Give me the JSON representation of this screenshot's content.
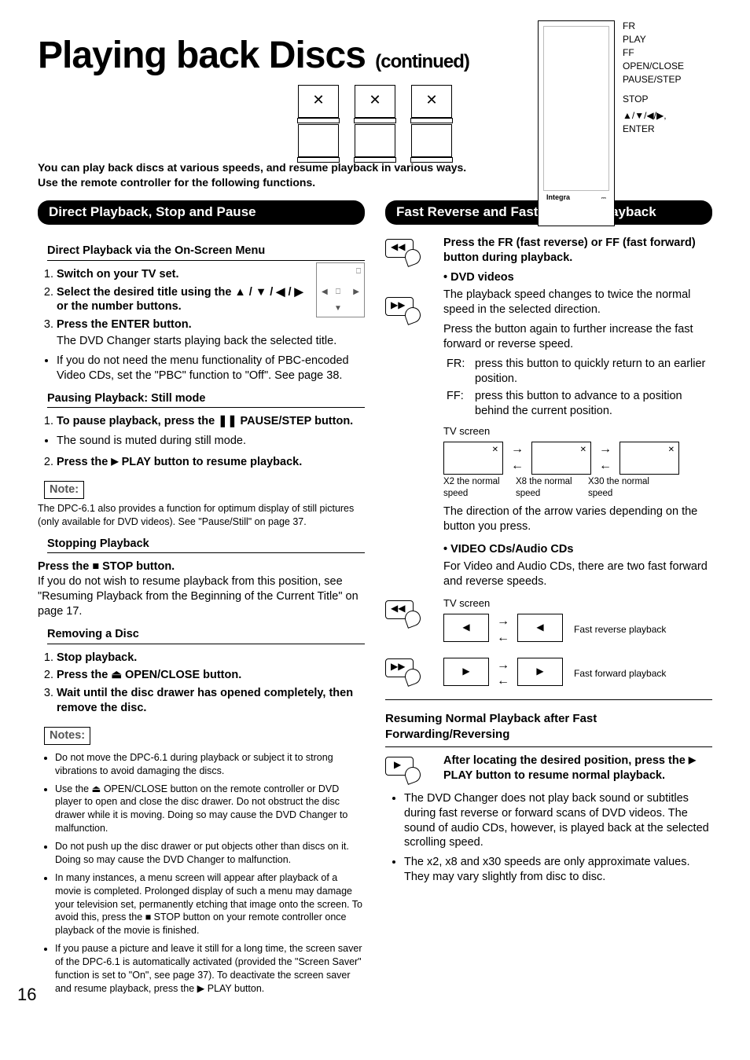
{
  "page_number": "16",
  "title_main": "Playing back Discs",
  "title_cont": "(continued)",
  "intro": "You can play back discs at various speeds, and resume playback in various ways. Use the remote controller for the following functions.",
  "remote_callouts": [
    "FR",
    "PLAY",
    "FF",
    "OPEN/CLOSE",
    "PAUSE/STEP",
    "STOP",
    "▲/▼/◀/▶,",
    "ENTER"
  ],
  "remote_brand": "Integra",
  "left": {
    "section_title": "Direct Playback, Stop and Pause",
    "sub1": "Direct Playback via the On-Screen Menu",
    "steps1": [
      "Switch on your TV set.",
      "Select the desired title using the ▲ / ▼ / ◀ / ▶ or the number buttons.",
      "Press the ENTER button."
    ],
    "steps1_tail": "The DVD Changer starts playing back the selected title.",
    "bullet1": "If you do not need the menu functionality of PBC-encoded Video CDs, set the \"PBC\" function to \"Off\". See page 38.",
    "sub2": "Pausing Playback: Still mode",
    "step2a": "To pause playback, press the ❚❚ PAUSE/STEP button.",
    "bullet2": "The sound is muted during still mode.",
    "step2b_prefix": "Press the ",
    "step2b_icon": "▶",
    "step2b_suffix": " PLAY button to resume playback.",
    "note_label": "Note:",
    "note_text": "The DPC-6.1 also provides a function for optimum display of still pictures (only available for DVD videos). See \"Pause/Still\" on page 37.",
    "sub3": "Stopping Playback",
    "stop_bold": "Press the ■ STOP button.",
    "stop_text": "If you do not wish to resume playback from this position, see \"Resuming Playback from the Beginning of the Current Title\" on page 17.",
    "sub4": "Removing a Disc",
    "steps4": [
      "Stop playback.",
      "Press the ⏏ OPEN/CLOSE button.",
      "Wait until the disc drawer has opened completely, then remove the disc."
    ],
    "notes_label": "Notes:",
    "notes": [
      "Do not move the DPC-6.1 during playback or subject it to strong vibrations to avoid damaging the discs.",
      "Use the ⏏ OPEN/CLOSE button on the remote controller or DVD player to open and close the disc drawer. Do not obstruct the disc drawer while it is moving. Doing so may cause the DVD Changer to malfunction.",
      "Do not push up the disc drawer or put objects other than discs on it. Doing so may cause the DVD Changer to malfunction.",
      "In many instances, a menu screen will appear after playback of a movie is completed. Prolonged display of such a menu may damage your television set, permanently etching that image onto the screen. To avoid this, press the ■ STOP button on your remote controller once playback of the movie is finished.",
      "If you pause a picture and leave it still for a long time, the screen saver of the DPC-6.1 is automatically activated (provided the \"Screen Saver\" function is set to \"On\", see page 37). To deactivate the screen saver and resume playback, press the ▶ PLAY button."
    ]
  },
  "right": {
    "section_title": "Fast Reverse and Fast Forward Playback",
    "subhead": "Press the FR (fast reverse) or FF (fast forward) button during playback.",
    "bul_dvd": "• DVD videos",
    "dvd_line1": "The playback speed changes to twice the normal speed in the selected direction.",
    "dvd_line2": "Press the button again to further increase the fast forward or reverse speed.",
    "fr_label": "FR:",
    "fr_text": "press this button to quickly return to an earlier position.",
    "ff_label": "FF:",
    "ff_text": "press this button to advance to a position behind the current position.",
    "tvscreen_label": "TV screen",
    "speed_caps": [
      "X2 the normal speed",
      "X8 the normal speed",
      "X30 the normal speed"
    ],
    "dir_text": "The direction of the arrow varies depending on the button you press.",
    "bul_vcd": "• VIDEO CDs/Audio CDs",
    "vcd_text": "For Video and Audio CDs, there are two fast forward and reverse speeds.",
    "rev_label": "Fast reverse playback",
    "fwd_label": "Fast forward playback",
    "resume_head": "Resuming Normal Playback after Fast Forwarding/Reversing",
    "resume_bold_prefix": "After locating the desired position, press the ",
    "resume_bold_icon": "▶",
    "resume_bold_suffix": " PLAY button to resume normal playback.",
    "resume_b1": "The DVD Changer does not play back sound or subtitles during fast reverse or forward scans of DVD videos. The sound of audio CDs, however, is played back at the selected scrolling speed.",
    "resume_b2": "The x2, x8 and x30 speeds are only approximate values. They may vary slightly from disc to disc."
  }
}
